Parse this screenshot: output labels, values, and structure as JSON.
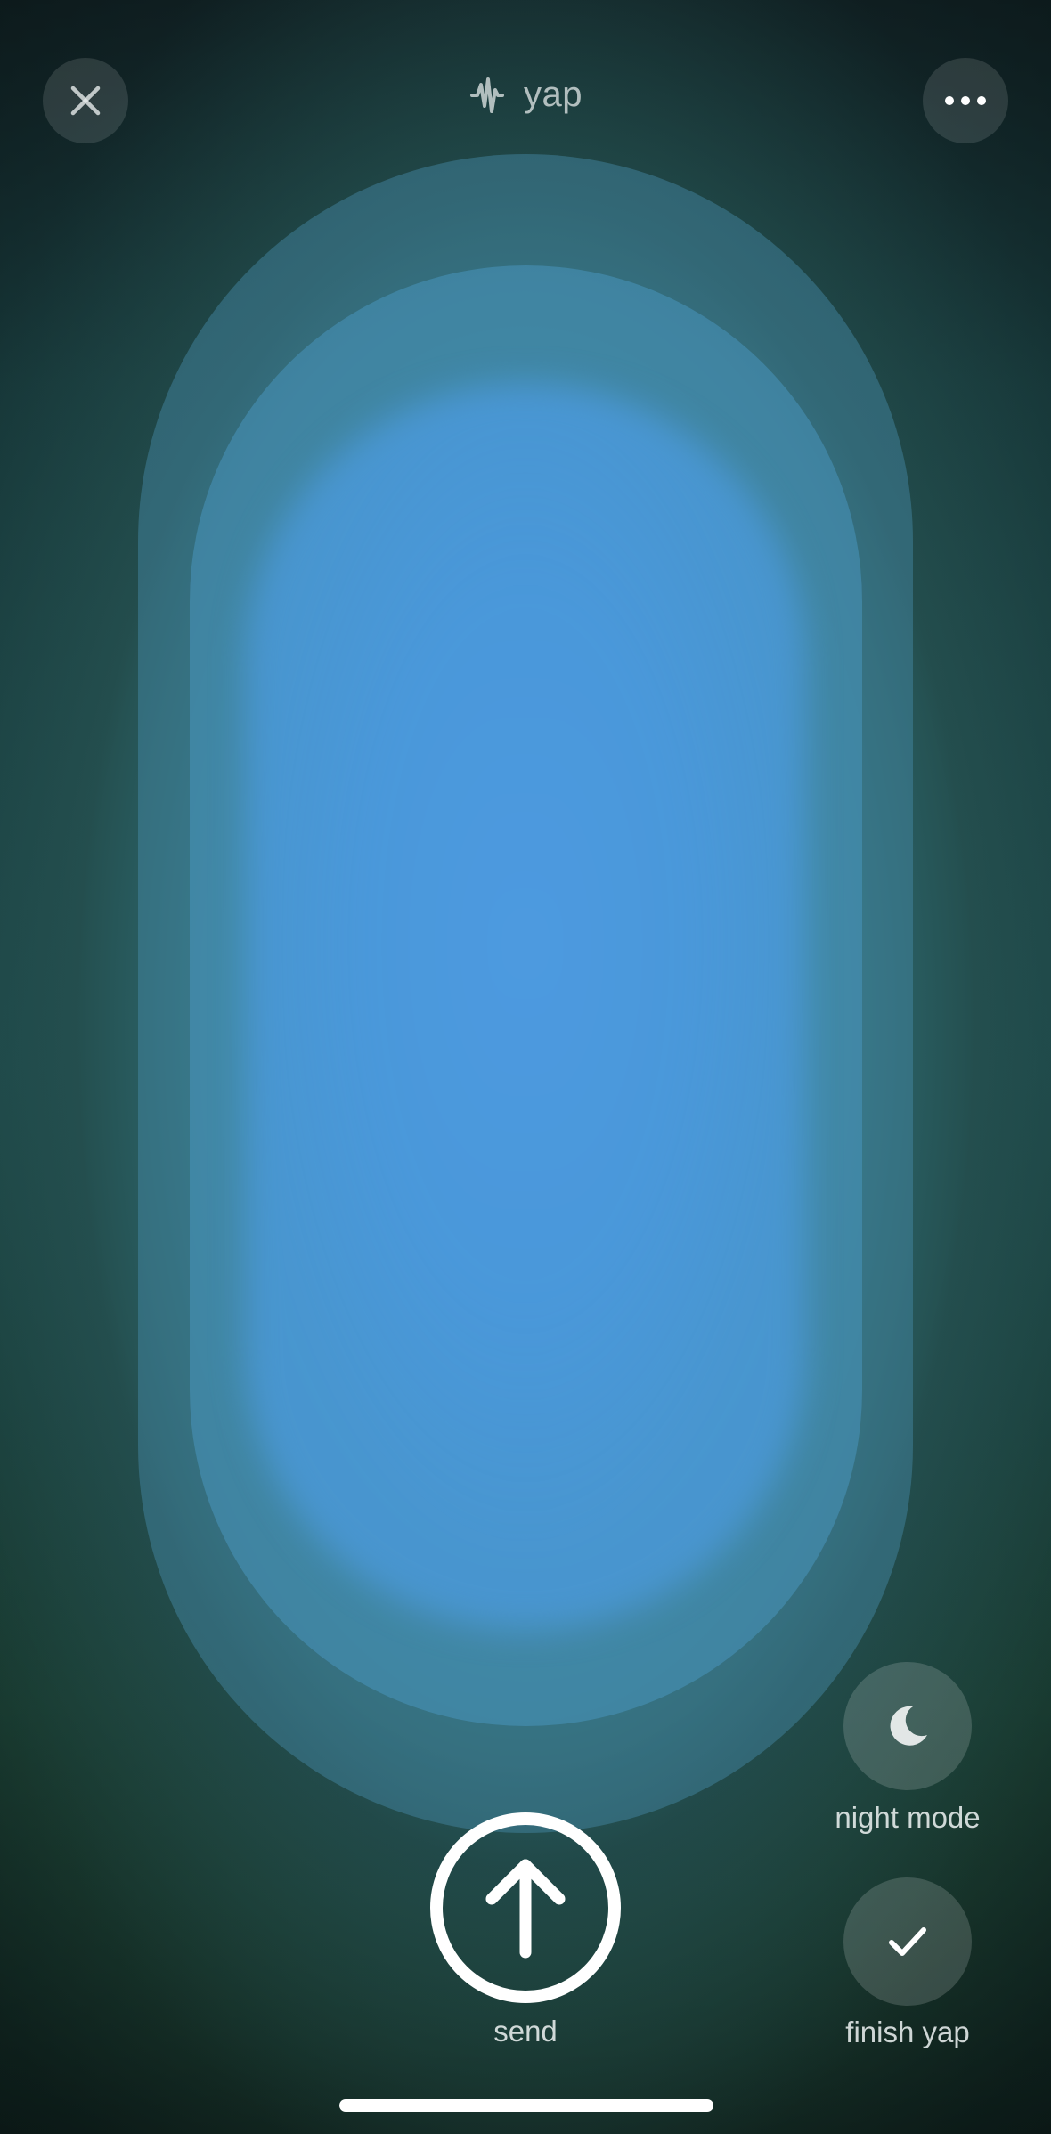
{
  "header": {
    "title": "yap",
    "title_icon": "sound-wave-icon",
    "close_icon": "close-icon",
    "more_icon": "more-horizontal-icon"
  },
  "controls": {
    "send_label": "send",
    "send_icon": "arrow-up-icon",
    "night_mode_label": "night mode",
    "night_mode_icon": "moon-icon",
    "finish_label": "finish yap",
    "finish_icon": "checkmark-icon"
  },
  "colors": {
    "orb_core": "#4d9ae0",
    "background_top": "#16282c",
    "background_mid": "#245a5a",
    "background_bottom": "#0e1a18"
  }
}
